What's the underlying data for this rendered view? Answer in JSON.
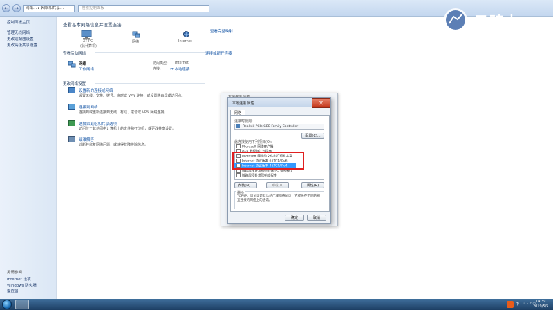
{
  "addressbar": {
    "back": "←",
    "forward": "→",
    "address_1": "网络...",
    "address_2": "网络和共享...",
    "search_placeholder": "搜索控制面板"
  },
  "leftpane": {
    "home": "控制面板主页",
    "links": [
      "管理无线网络",
      "更改适配器设置",
      "更改高级共享设置"
    ],
    "see_also_title": "另请参阅",
    "see_also": [
      "Internet 选项",
      "Windows 防火墙",
      "家庭组"
    ]
  },
  "main": {
    "title": "查看基本网络信息并设置连接",
    "see_full_map": "查看完整映射",
    "map": {
      "computer": "XT-PC",
      "computer_sub": "(此计算机)",
      "network": "网络",
      "internet": "Internet"
    },
    "active_title": "查看活动网络",
    "connect_disconnect": "连接或断开连接",
    "network_name": "网络",
    "network_type": "工作网络",
    "access_type_label": "访问类型:",
    "access_type_value": "Internet",
    "connection_label": "连接:",
    "connection_value": "本地连接",
    "change_title": "更改网络设置",
    "tasks": [
      {
        "link": "设置新的连接或网络",
        "desc": "设置无线、宽带、拨号、临时或 VPN 连接；或设置路由器或访问点。"
      },
      {
        "link": "连接到网络",
        "desc": "连接到或重新连接到无线、有线、拨号或 VPN 网络连接。"
      },
      {
        "link": "选择家庭组和共享选项",
        "desc": "访问位于其他网络计算机上的文件和打印机，或更改共享设置。"
      },
      {
        "link": "疑难解答",
        "desc": "诊断并修复网络问题，或获得故障排除信息。"
      }
    ]
  },
  "dialog_back": {
    "title": "本地连接 状态"
  },
  "dialog": {
    "title": "本地连接 属性",
    "close": "✕",
    "tab": "网络",
    "connect_using_label": "连接时使用:",
    "adapter": "Realtek PCIe GBE Family Controller",
    "configure": "配置(C)...",
    "items_label": "此连接使用下列项目(O):",
    "items": [
      "Microsoft 网络客户端",
      "QoS 数据包计划程序",
      "Microsoft 网络的文件和打印机共享",
      "Internet 协议版本 6 (TCP/IPv6)",
      "Internet 协议版本 4 (TCP/IPv4)",
      "链路层拓扑发现映射器 I/O 驱动程序",
      "链路层拓扑发现响应程序"
    ],
    "install": "安装(N)...",
    "uninstall": "卸载(U)",
    "properties": "属性(R)",
    "description_label": "描述",
    "description": "TCP/IP。该协议是默认的广域网络协议，它提供在不同的相互连接的网络上的通讯。",
    "ok": "确定",
    "cancel": "取消"
  },
  "taskbar": {
    "clock_time": "14:39",
    "clock_date": "2019/5/5",
    "ime": "中"
  },
  "watermark": {
    "text": "云骑士"
  }
}
